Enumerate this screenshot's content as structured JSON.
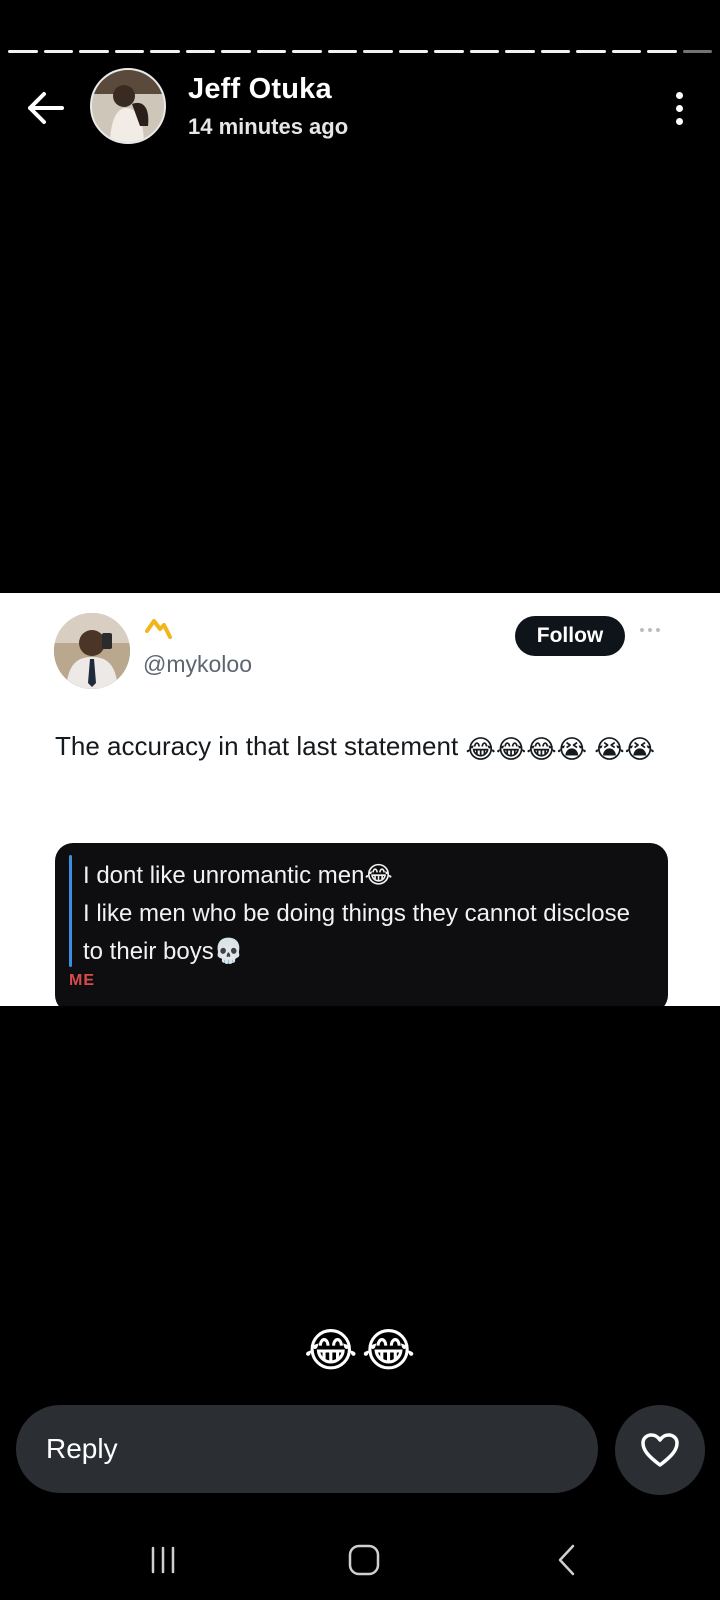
{
  "story": {
    "progress_segments": 20,
    "viewed_segments": 19
  },
  "header": {
    "user_name": "Jeff Otuka",
    "timestamp": "14 minutes ago",
    "back_icon": "arrow-left-icon",
    "menu_icon": "more-vertical-icon"
  },
  "post": {
    "handle": "@mykoloo",
    "follow_label": "Follow",
    "text": "The accuracy in that last statement",
    "text_emojis": [
      "😂",
      "😂",
      "😂",
      "😭",
      "😭",
      "😭"
    ],
    "quote": {
      "line1": "I dont like unromantic men😂",
      "line2": "I like men who be doing things they cannot disclose to their boys💀",
      "label": "ME"
    }
  },
  "reaction": {
    "emojis": [
      "😂",
      "😂"
    ]
  },
  "reply_bar": {
    "placeholder": "Reply",
    "like_icon": "heart-icon"
  },
  "navbar": {
    "recents_icon": "recents-icon",
    "home_icon": "home-icon",
    "back_icon": "chevron-left-icon"
  },
  "colors": {
    "background": "#000000",
    "reply_bg": "#2b2f33",
    "follow_bg": "#0e1419",
    "quote_accent": "#3b8ee0",
    "quote_label": "#d94a4a"
  }
}
